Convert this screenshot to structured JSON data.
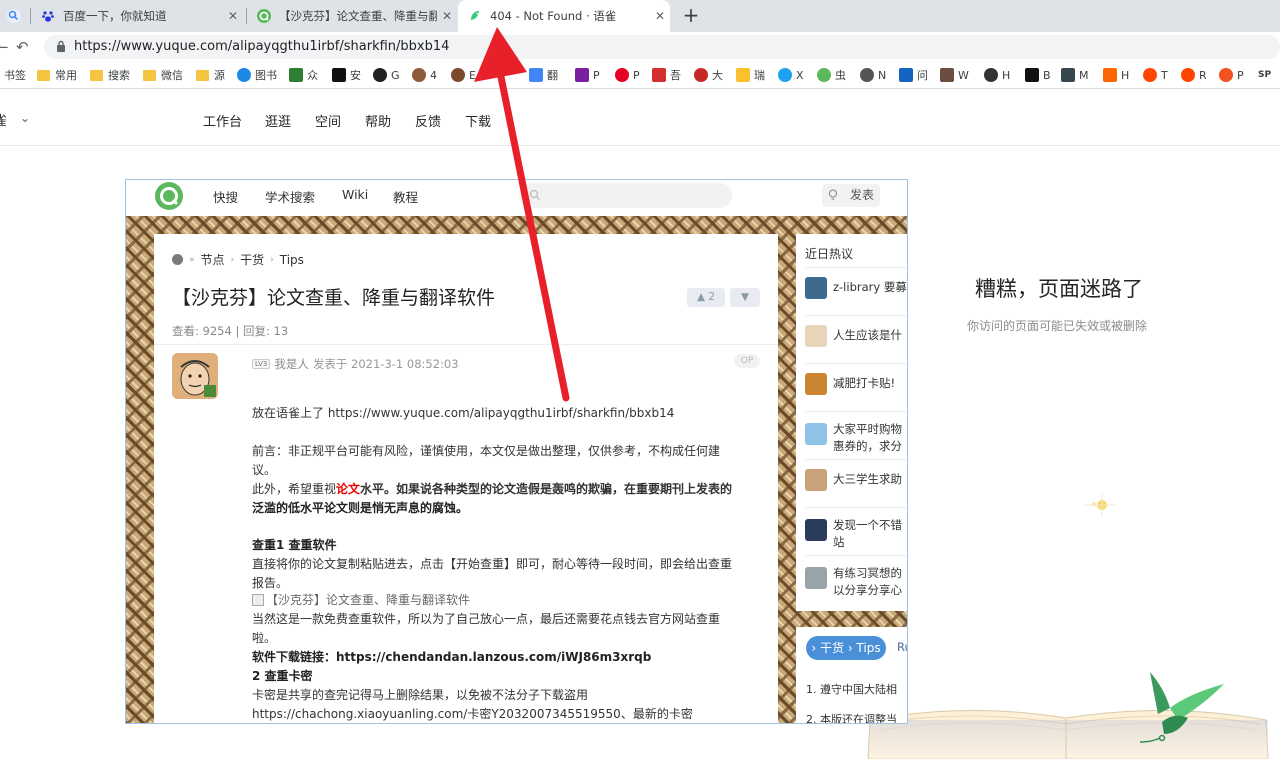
{
  "browser": {
    "tabs": [
      {
        "title": "百度一下，你就知道"
      },
      {
        "title": "【沙克芬】论文查重、降重与翻译软件"
      },
      {
        "title": "404 - Not Found · 语雀"
      }
    ],
    "url_host": "https://www.yuque.com",
    "url_path": "/alipayqgthu1irbf/sharkfin/bbxb14"
  },
  "bookmarks": [
    "书签",
    "常用",
    "搜索",
    "微信",
    "源",
    "图书",
    "众",
    "安",
    "G",
    "4",
    "E",
    "",
    "翻",
    "P",
    "P",
    "吾",
    "大",
    "瑞",
    "X",
    "虫",
    "N",
    "问",
    "W",
    "H",
    "B",
    "M",
    "H",
    "T",
    "R",
    "P",
    "SP"
  ],
  "yuque": {
    "menu_left": "雀",
    "nav": [
      "工作台",
      "逛逛",
      "空间",
      "帮助",
      "反馈",
      "下载"
    ],
    "not_found_title": "糟糕，页面迷路了",
    "not_found_sub": "你访问的页面可能已失效或被删除"
  },
  "embed": {
    "header_nav": [
      "快搜",
      "学术搜索",
      "Wiki",
      "教程"
    ],
    "post_button": "发表",
    "breadcrumbs": [
      "节点",
      "干货",
      "Tips"
    ],
    "title": "【沙克芬】论文查重、降重与翻译软件",
    "vote_up": "▲ 2",
    "vote_down": "▼",
    "stats": "查看: 9254  |  回复: 13",
    "level": "LV3",
    "author": "我是人",
    "posted": "发表于 2021-3-1 08:52:03",
    "op": "OP",
    "lines": [
      "放在语雀上了 https://www.yuque.com/alipayqgthu1irbf/sharkfin/bbxb14",
      "前言：非正规平台可能有风险，谨慎使用，本文仅是做出整理，仅供参考，不构成任何建",
      "议。",
      "此外，希望重视",
      "论文",
      "水平。如果说各种类型的论文造假是轰鸣的欺骗，在重要期刊上发表的",
      "泛滥的低水平论文则是悄无声息的腐蚀。",
      "查重1 查重软件",
      "直接将你的论文复制粘贴进去，点击【开始查重】即可，耐心等待一段时间，即会给出查重",
      "报告。",
      "【沙克芬】论文查重、降重与翻译软件",
      "当然这是一款免费查重软件，所以为了自己放心一点，最后还需要花点钱去官方网站查重",
      "啦。",
      "软件下载链接：https://chendandan.lanzous.com/iWJ86m3xrqb",
      "2 查重卡密",
      "卡密是共享的查完记得马上删除结果，以免被不法分子下载盗用",
      "https://chachong.xiaoyuanling.com/卡密Y2032007345519550、最新的卡密"
    ],
    "sidebar_title": "近日热议",
    "sidebar_items": [
      [
        "z-library 要募"
      ],
      [
        "人生应该是什"
      ],
      [
        "减肥打卡贴!"
      ],
      [
        "大家平时购物",
        "惠券的，求分"
      ],
      [
        "大三学生求助"
      ],
      [
        "发现一个不错",
        "站"
      ],
      [
        "有练习冥想的",
        "以分享分享心"
      ]
    ],
    "pill": "› 干货 › Tips",
    "pill_more": "Ru",
    "rules": [
      "1. 遵守中国大陆相",
      "2. 本版还在调整当"
    ]
  },
  "colors": {
    "arrow": "#e8202a",
    "accent": "#4a90d9",
    "tab_bg": "#dfe3e8"
  }
}
